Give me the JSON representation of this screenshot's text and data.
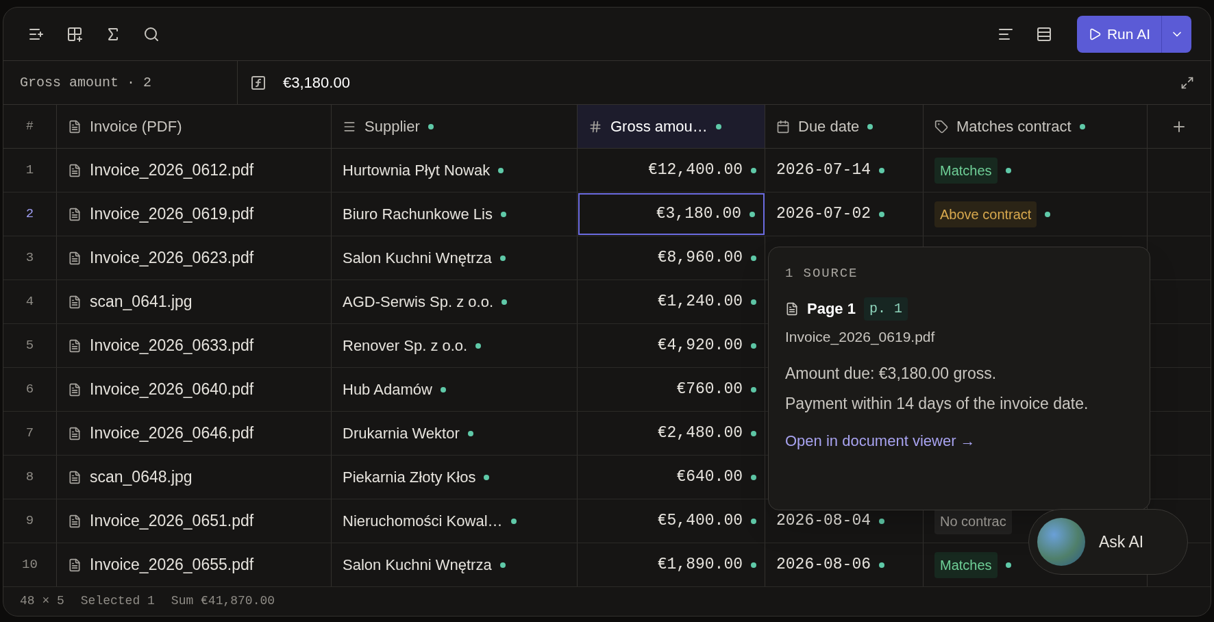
{
  "toolbar": {
    "run_button": {
      "label": "Run AI"
    }
  },
  "formula_bar": {
    "cell_ref": "Gross amount · 2",
    "value": "€3,180.00"
  },
  "table": {
    "columns": [
      {
        "label": "#",
        "kind": "index",
        "selected": false
      },
      {
        "label": "Invoice (PDF)",
        "kind": "file",
        "selected": false
      },
      {
        "label": "Supplier",
        "kind": "text",
        "selected": false
      },
      {
        "label": "Gross amou…",
        "kind": "number",
        "selected": true
      },
      {
        "label": "Due date",
        "kind": "date",
        "selected": false
      },
      {
        "label": "Matches contract",
        "kind": "tag",
        "selected": false
      }
    ],
    "rows": [
      {
        "number": "1",
        "selected": false,
        "invoice": "Invoice_2026_0612.pdf",
        "supplier": "Hurtownia Płyt Nowak",
        "amount": "€12,400.00",
        "due_date": "2026-07-14",
        "match": {
          "label": "Matches",
          "kind": "ok"
        }
      },
      {
        "number": "2",
        "selected": true,
        "invoice": "Invoice_2026_0619.pdf",
        "supplier": "Biuro Rachunkowe Lis",
        "amount": "€3,180.00",
        "due_date": "2026-07-02",
        "match": {
          "label": "Above contract",
          "kind": "warn"
        }
      },
      {
        "number": "3",
        "selected": false,
        "invoice": "Invoice_2026_0623.pdf",
        "supplier": "Salon Kuchni Wnętrza",
        "amount": "€8,960.00"
      },
      {
        "number": "4",
        "selected": false,
        "invoice": "scan_0641.jpg",
        "supplier": "AGD-Serwis Sp. z o.o.",
        "amount": "€1,240.00"
      },
      {
        "number": "5",
        "selected": false,
        "invoice": "Invoice_2026_0633.pdf",
        "supplier": "Renover Sp. z o.o.",
        "amount": "€4,920.00"
      },
      {
        "number": "6",
        "selected": false,
        "invoice": "Invoice_2026_0640.pdf",
        "supplier": "Hub Adamów",
        "amount": "€760.00"
      },
      {
        "number": "7",
        "selected": false,
        "invoice": "Invoice_2026_0646.pdf",
        "supplier": "Drukarnia Wektor",
        "amount": "€2,480.00"
      },
      {
        "number": "8",
        "selected": false,
        "invoice": "scan_0648.jpg",
        "supplier": "Piekarnia Złoty Kłos",
        "amount": "€640.00"
      },
      {
        "number": "9",
        "selected": false,
        "invoice": "Invoice_2026_0651.pdf",
        "supplier": "Nieruchomości Kowal…",
        "amount": "€5,400.00",
        "due_date": "2026-08-04",
        "match": {
          "label": "No contrac",
          "kind": "none"
        }
      },
      {
        "number": "10",
        "selected": false,
        "invoice": "Invoice_2026_0655.pdf",
        "supplier": "Salon Kuchni Wnętrza",
        "amount": "€1,890.00",
        "due_date": "2026-08-06",
        "match": {
          "label": "Matches",
          "kind": "ok"
        }
      }
    ]
  },
  "popover": {
    "heading": "1 SOURCE",
    "page_title": "Page 1",
    "page_tag": "p. 1",
    "filename": "Invoice_2026_0619.pdf",
    "body": [
      "Amount due: €3,180.00 gross.",
      "Payment within 14 days of the invoice date."
    ],
    "link": "Open in document viewer →"
  },
  "footer": [
    "48 × 5",
    "Selected 1",
    "Sum €41,870.00"
  ],
  "ask_ai": {
    "label": "Ask AI"
  }
}
